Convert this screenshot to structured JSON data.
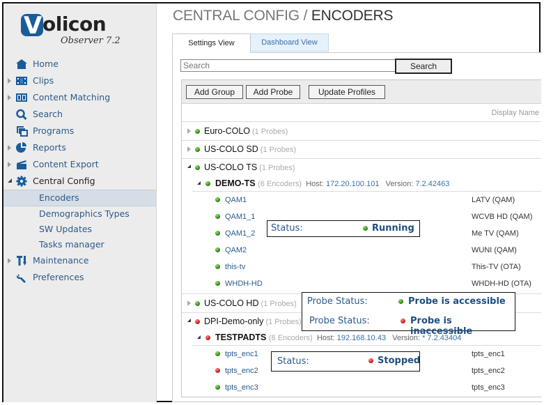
{
  "brand": {
    "name": "Volicon",
    "logo_letter": "V",
    "logo_rest": "olicon",
    "product": "Observer 7.2",
    "color": "#1a5c9a"
  },
  "sidebar": {
    "items": [
      {
        "label": "Home",
        "icon": "home-icon",
        "expandable": false
      },
      {
        "label": "Clips",
        "icon": "film-icon",
        "expandable": true
      },
      {
        "label": "Content Matching",
        "icon": "content-matching-icon",
        "expandable": true
      },
      {
        "label": "Search",
        "icon": "search-icon",
        "expandable": false
      },
      {
        "label": "Programs",
        "icon": "programs-icon",
        "expandable": false
      },
      {
        "label": "Reports",
        "icon": "pie-chart-icon",
        "expandable": true
      },
      {
        "label": "Content Export",
        "icon": "clapperboard-icon",
        "expandable": true
      },
      {
        "label": "Central Config",
        "icon": "gear-icon",
        "expandable": true,
        "expanded": true,
        "children": [
          {
            "label": "Encoders",
            "selected": true
          },
          {
            "label": "Demographics Types"
          },
          {
            "label": "SW Updates"
          },
          {
            "label": "Tasks manager"
          }
        ]
      },
      {
        "label": "Maintenance",
        "icon": "tools-icon",
        "expandable": true
      },
      {
        "label": "Preferences",
        "icon": "wrench-icon",
        "expandable": false
      }
    ]
  },
  "header": {
    "crumb": "CENTRAL CONFIG",
    "separator": " / ",
    "current": "ENCODERS"
  },
  "tabs": [
    {
      "label": "Settings View",
      "active": true
    },
    {
      "label": "Dashboard View",
      "active": false
    }
  ],
  "search": {
    "placeholder": "Search",
    "value": "",
    "button": "Search"
  },
  "toolbar": {
    "add_group": "Add Group",
    "add_probe": "Add Probe",
    "update_profiles": "Update Profiles"
  },
  "columns": {
    "display_name": "Display Name"
  },
  "labels": {
    "host": "Host:",
    "version": "Version:"
  },
  "groups": [
    {
      "name": "Euro-COLO",
      "count": "(1 Probes)",
      "status": "green",
      "expanded": false
    },
    {
      "name": "US-COLO SD",
      "count": "(1 Probes)",
      "status": "green",
      "expanded": false
    },
    {
      "name": "US-COLO TS",
      "count": "(1 Probes)",
      "status": "green",
      "expanded": true,
      "probe": {
        "name": "DEMO-TS",
        "count": "(6 Encoders)",
        "host": "172.20.100.101",
        "version": "7.2.42463",
        "status": "green",
        "encoders": [
          {
            "name": "QAM1",
            "display": "LATV (QAM)",
            "status": "green"
          },
          {
            "name": "QAM1_1",
            "display": "WCVB HD (QAM)",
            "status": "green"
          },
          {
            "name": "QAM1_2",
            "display": "Me TV (QAM)",
            "status": "green"
          },
          {
            "name": "QAM2",
            "display": "WUNI (QAM)",
            "status": "green"
          },
          {
            "name": "this-tv",
            "display": "This-TV (OTA)",
            "status": "green"
          },
          {
            "name": "WHDH-HD",
            "display": "WHDH-HD (OTA)",
            "status": "green"
          }
        ]
      }
    },
    {
      "name": "US-COLO HD",
      "count": "(1 Probes)",
      "status": "green",
      "expanded": false
    },
    {
      "name": "DPI-Demo-only",
      "count": "(1 Probes)",
      "status": "red",
      "expanded": true,
      "probe": {
        "name": "TESTPADTS",
        "count": "(8 Encoders)",
        "host": "192.168.10.43",
        "version": "* 7.2.43404",
        "status": "red",
        "encoders": [
          {
            "name": "tpts_enc1",
            "display": "tpts_enc1",
            "status": "green"
          },
          {
            "name": "tpts_enc2",
            "display": "tpts_enc2",
            "status": "red"
          },
          {
            "name": "tpts_enc3",
            "display": "tpts_enc3",
            "status": "green"
          }
        ]
      }
    }
  ],
  "callouts": {
    "running": {
      "key": "Status:",
      "value": "Running",
      "status": "green"
    },
    "probe_accessible": {
      "key": "Probe Status:",
      "value": "Probe is accessible",
      "status": "green"
    },
    "probe_inaccessible": {
      "key": "Probe Status:",
      "value": "Probe is inaccessible",
      "status": "red"
    },
    "stopped": {
      "key": "Status:",
      "value": "Stopped",
      "status": "red"
    }
  },
  "colors": {
    "link": "#2b5a8c",
    "status_green": "#2f8a1b",
    "status_red": "#cc1f1f",
    "muted": "#aaaaaa"
  }
}
